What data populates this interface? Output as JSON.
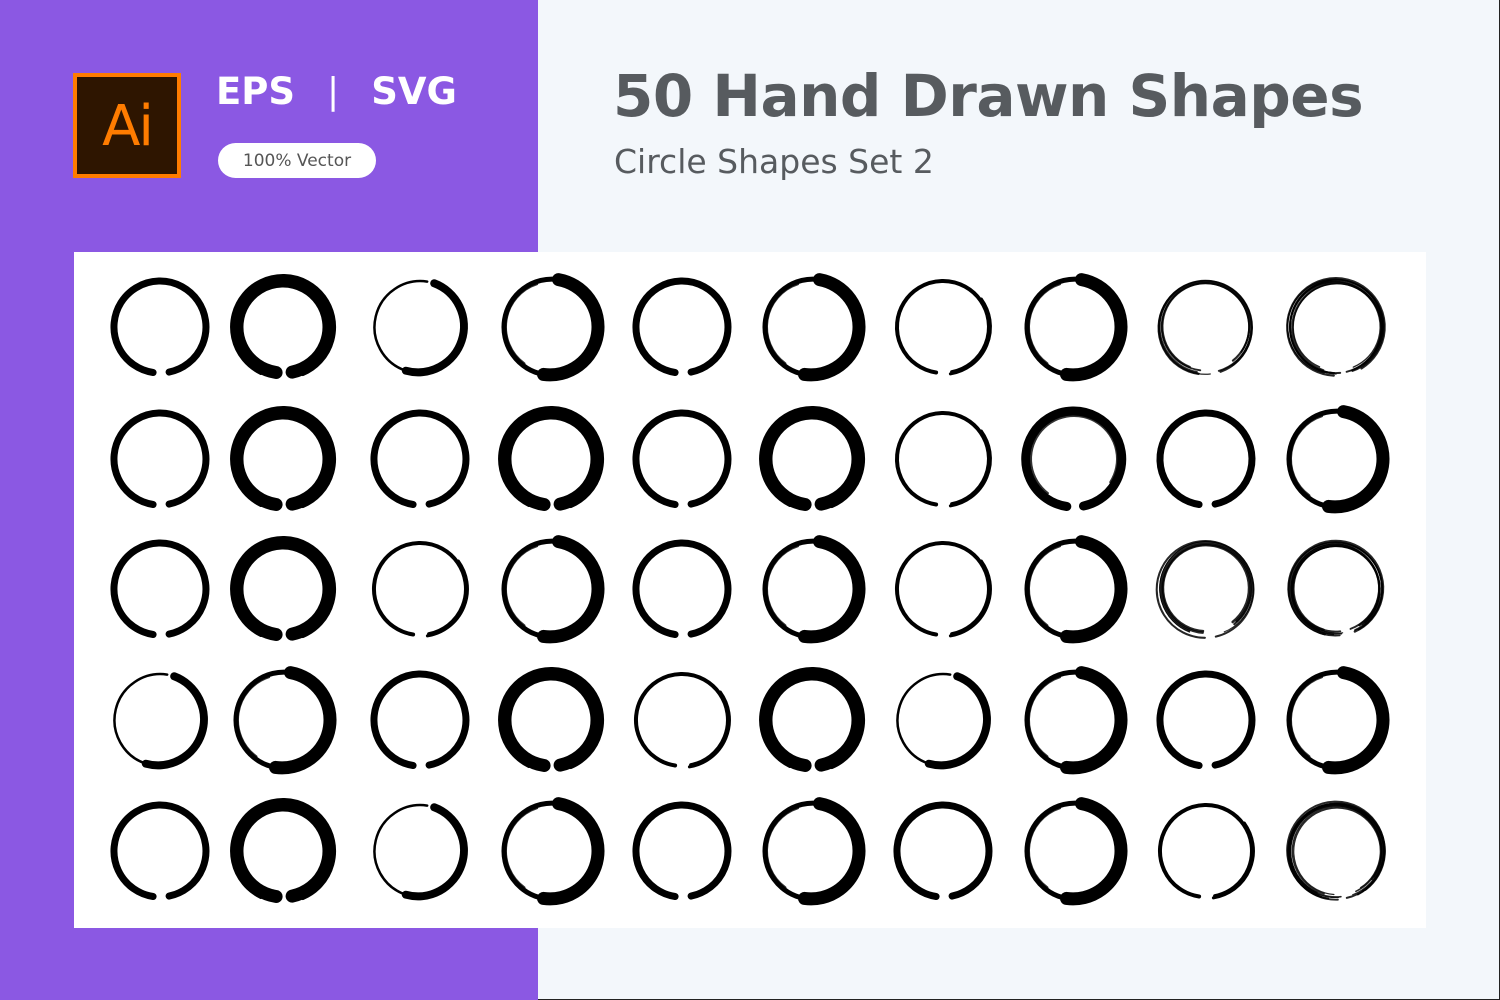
{
  "branding": {
    "app_icon": "adobe-illustrator-icon",
    "app_icon_text": "Ai",
    "formats": [
      "EPS",
      "SVG"
    ],
    "format_separator": "|",
    "badge": "100% Vector"
  },
  "header": {
    "title": "50 Hand Drawn Shapes",
    "subtitle": "Circle Shapes Set 2"
  },
  "colors": {
    "purple": "#8B58E3",
    "background": "#F3F7FB",
    "panel": "#FFFFFF",
    "text": "#575B5F",
    "ai_orange": "#FF7C00",
    "ai_dark": "#2E1500",
    "shape": "#000000"
  },
  "shapes": {
    "count": 50,
    "rows": 5,
    "columns": 10,
    "kind": "brush-stroke circle",
    "styles": [
      [
        "medium",
        "thick",
        "thin-taper",
        "thick-crescent",
        "medium",
        "thick-crescent",
        "thin",
        "thick-crescent",
        "sketchy",
        "sketchy-dense"
      ],
      [
        "medium",
        "thick",
        "medium",
        "thick",
        "medium",
        "thick",
        "thin",
        "thick-sketchy",
        "medium",
        "thick-crescent"
      ],
      [
        "medium",
        "thick",
        "thin",
        "thick-crescent",
        "medium",
        "thick-crescent",
        "thin",
        "thick-crescent",
        "sketchy",
        "sketchy-dense"
      ],
      [
        "thin-taper",
        "thick-crescent",
        "medium",
        "thick",
        "thin",
        "thick",
        "thin-taper",
        "thick-crescent",
        "medium",
        "thick-crescent"
      ],
      [
        "medium",
        "thick-broken",
        "thin-taper",
        "thick-crescent",
        "medium",
        "thick-crescent",
        "medium",
        "thick-crescent",
        "thin",
        "sketchy-dense"
      ]
    ]
  }
}
